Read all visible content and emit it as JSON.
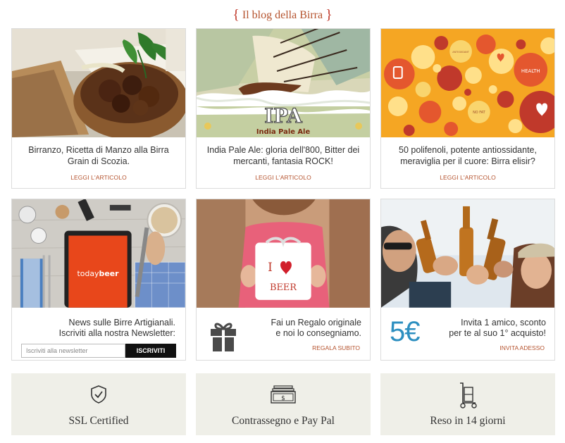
{
  "blog": {
    "title": "Il blog della Birra",
    "brace_left": "{",
    "brace_right": "}"
  },
  "articles": [
    {
      "caption": "Birranzo, Ricetta di Manzo alla Birra Grain di Scozia.",
      "link": "LEGGI L'ARTICOLO"
    },
    {
      "caption": "India Pale Ale: gloria dell'800, Bitter dei mercanti, fantasia ROCK!",
      "link": "LEGGI L'ARTICOLO",
      "image_title": "IPA",
      "image_subtitle": "India Pale Ale"
    },
    {
      "caption": "50 polifenoli, potente antiossidante, meraviglia per il cuore: Birra elisir?",
      "link": "LEGGI L'ARTICOLO",
      "bubble_words": [
        "HEALTH",
        "ANTIOXIDANT",
        "NO FAT"
      ]
    }
  ],
  "newsletter": {
    "text_line1": "News sulle Birre Artigianali.",
    "text_line2": "Iscriviti alla nostra Newsletter:",
    "placeholder": "Iscriviti alla newsletter",
    "button": "ISCRIVITI",
    "tablet_brand_a": "today",
    "tablet_brand_b": "beer"
  },
  "gift": {
    "line1": "Fai un Regalo originale",
    "line2": "e noi lo consegniamo.",
    "link": "REGALA SUBITO",
    "box_text_i": "I",
    "box_text_beer": "BEER"
  },
  "invite": {
    "amount": "5€",
    "line1": "Invita 1 amico, sconto",
    "line2": "per te al suo 1° acquisto!",
    "link": "INVITA ADESSO"
  },
  "features": [
    {
      "label": "SSL Certified",
      "icon": "shield-check-icon"
    },
    {
      "label": "Contrassegno e Pay Pal",
      "icon": "banknote-icon"
    },
    {
      "label": "Reso in 14 giorni",
      "icon": "hand-truck-icon"
    }
  ],
  "colors": {
    "accent": "#b5532e",
    "euro_blue": "#2d8fc0",
    "feature_bg": "#efefe8"
  }
}
